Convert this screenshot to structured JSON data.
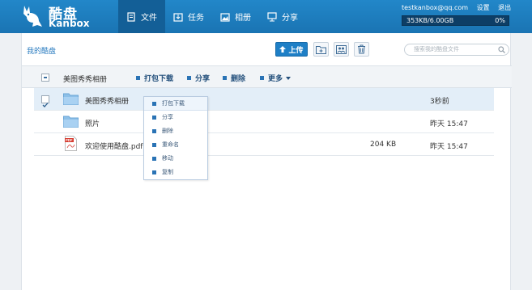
{
  "brand": {
    "name_cn": "酷盘",
    "name_en": "Kanbox"
  },
  "nav": [
    {
      "label": "文件",
      "icon": "file-icon",
      "active": true
    },
    {
      "label": "任务",
      "icon": "task-icon",
      "active": false
    },
    {
      "label": "相册",
      "icon": "album-icon",
      "active": false
    },
    {
      "label": "分享",
      "icon": "share-icon",
      "active": false
    }
  ],
  "account": {
    "email": "testkanbox@qq.com",
    "settings": "设置",
    "logout": "退出"
  },
  "quota": {
    "used": "353KB/6.00GB",
    "percent": "0%",
    "fraction": 0.0
  },
  "breadcrumb": "我的酷盘",
  "toolbar": {
    "upload": "上传",
    "new_folder_icon": "new-folder-icon",
    "share_folder_icon": "share-folder-icon",
    "delete_icon": "trash-icon"
  },
  "search": {
    "placeholder": "搜索我的酷盘文件"
  },
  "actionbar": {
    "selected_name": "美图秀秀相册",
    "download": "打包下载",
    "share": "分享",
    "delete": "删除",
    "more": "更多"
  },
  "files": [
    {
      "name": "美图秀秀相册",
      "type": "folder",
      "size": "",
      "time": "3秒前",
      "selected": true
    },
    {
      "name": "照片",
      "type": "folder",
      "size": "",
      "time": "昨天 15:47",
      "selected": false
    },
    {
      "name": "欢迎使用酷盘.pdf",
      "type": "pdf",
      "size": "204 KB",
      "time": "昨天 15:47",
      "selected": false
    }
  ],
  "context_menu": [
    "打包下载",
    "分享",
    "删除",
    "重命名",
    "移动",
    "复制"
  ],
  "colors": {
    "topbar": "#1a74b3",
    "accent": "#2a73b5",
    "selected_row": "#e3eef8"
  }
}
